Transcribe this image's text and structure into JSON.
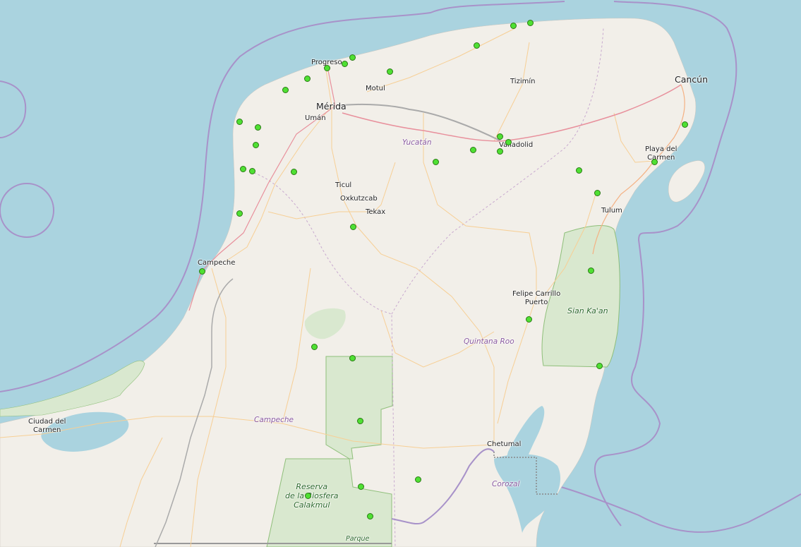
{
  "map": {
    "colors": {
      "water": "#aad3df",
      "land": "#f2efe9",
      "park": "#d9e8cf",
      "boundary": "#a892c9",
      "motorway": "#e8909c",
      "road": "#f7cf95",
      "marker_fill": "#4fe033",
      "marker_stroke": "#2a7a14"
    },
    "cities": {
      "cancun": "Cancún",
      "merida": "Mérida",
      "progreso": "Progreso",
      "motul": "Motul",
      "tizimin": "Tizimín",
      "uman": "Umán",
      "valladolid": "Valladolid",
      "playa_line1": "Playa del",
      "playa_line2": "Carmen",
      "ticul": "Ticul",
      "oxkutzcab": "Oxkutzcab",
      "tekax": "Tekax",
      "tulum": "Tulum",
      "campeche_city": "Campeche",
      "fcp_line1": "Felipe Carrillo",
      "fcp_line2": "Puerto",
      "chetumal": "Chetumal",
      "cdc_line1": "Ciudad del",
      "cdc_line2": "Carmen"
    },
    "regions": {
      "yucatan": "Yucatán",
      "quintana_roo": "Quintana Roo",
      "campeche": "Campeche",
      "corozal": "Corozal"
    },
    "parks": {
      "siankaan": "Sian Ka'an",
      "calakmul_line1": "Reserva",
      "calakmul_line2": "de la Biosfera",
      "calakmul_line3": "Calakmul",
      "parque": "Parque"
    }
  }
}
